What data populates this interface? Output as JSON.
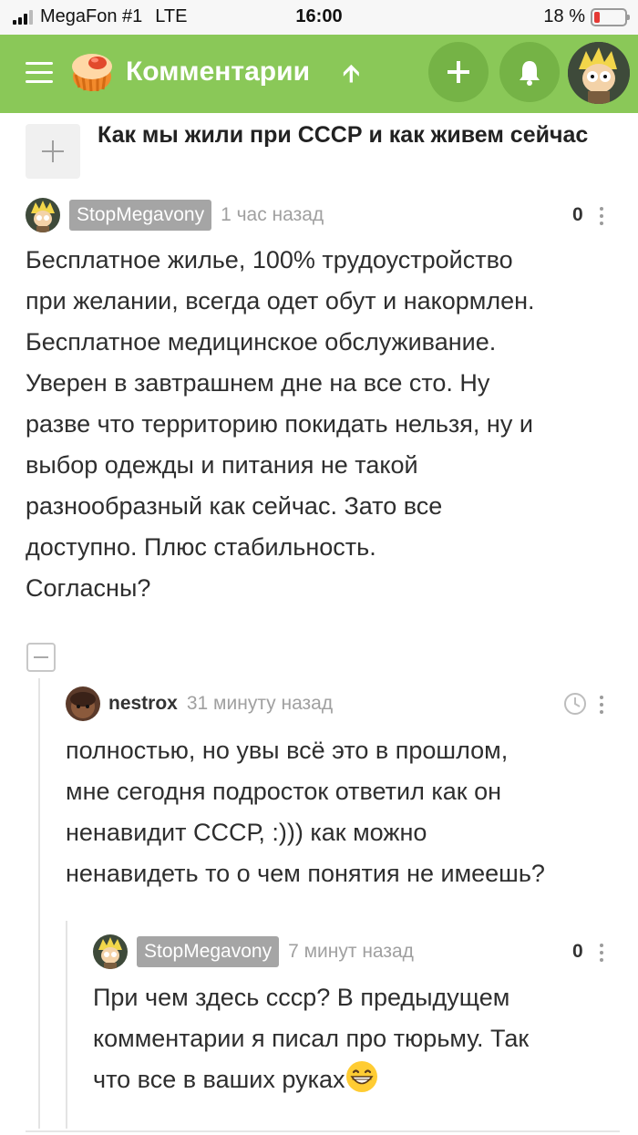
{
  "status_bar": {
    "carrier": "MegaFon #1",
    "network": "LTE",
    "time": "16:00",
    "battery": "18 %",
    "battery_level": 0.18
  },
  "app_bar": {
    "title": "Комментарии",
    "sort_icon": "arrow-up-icon",
    "accent_color": "#8ac858"
  },
  "post": {
    "title": "Как  мы жили при СССР и как живем сейчас"
  },
  "comments": [
    {
      "author": "StopMegavony",
      "time": "1 час назад",
      "rating": "0",
      "lines": [
        "Бесплатное жилье, 100% трудоустройство",
        "при желании, всегда одет обут и накормлен.",
        "Бесплатное медицинское обслуживание.",
        "Уверен в завтрашнем дне на все сто. Ну",
        "разве что территорию покидать нельзя, ну и",
        "выбор одежды и питания не такой",
        "разнообразный как сейчас. Зато все",
        "доступно. Плюс стабильность.",
        "Согласны?"
      ]
    },
    {
      "author": "nestrox",
      "time": "31 минуту назад",
      "lines": [
        "полностью, но увы всё это в прошлом,",
        "мне сегодня подросток ответил как он",
        "ненавидит СССР, :))) как можно",
        "ненавидеть то о чем понятия не имеешь?"
      ]
    },
    {
      "author": "StopMegavony",
      "time": "7 минут назад",
      "rating": "0",
      "lines": [
        "При чем здесь ссср? В предыдущем",
        "комментарии я писал про тюрьму. Так",
        "что все в ваших руках"
      ],
      "emoji": "grinning-face-emoji"
    }
  ]
}
